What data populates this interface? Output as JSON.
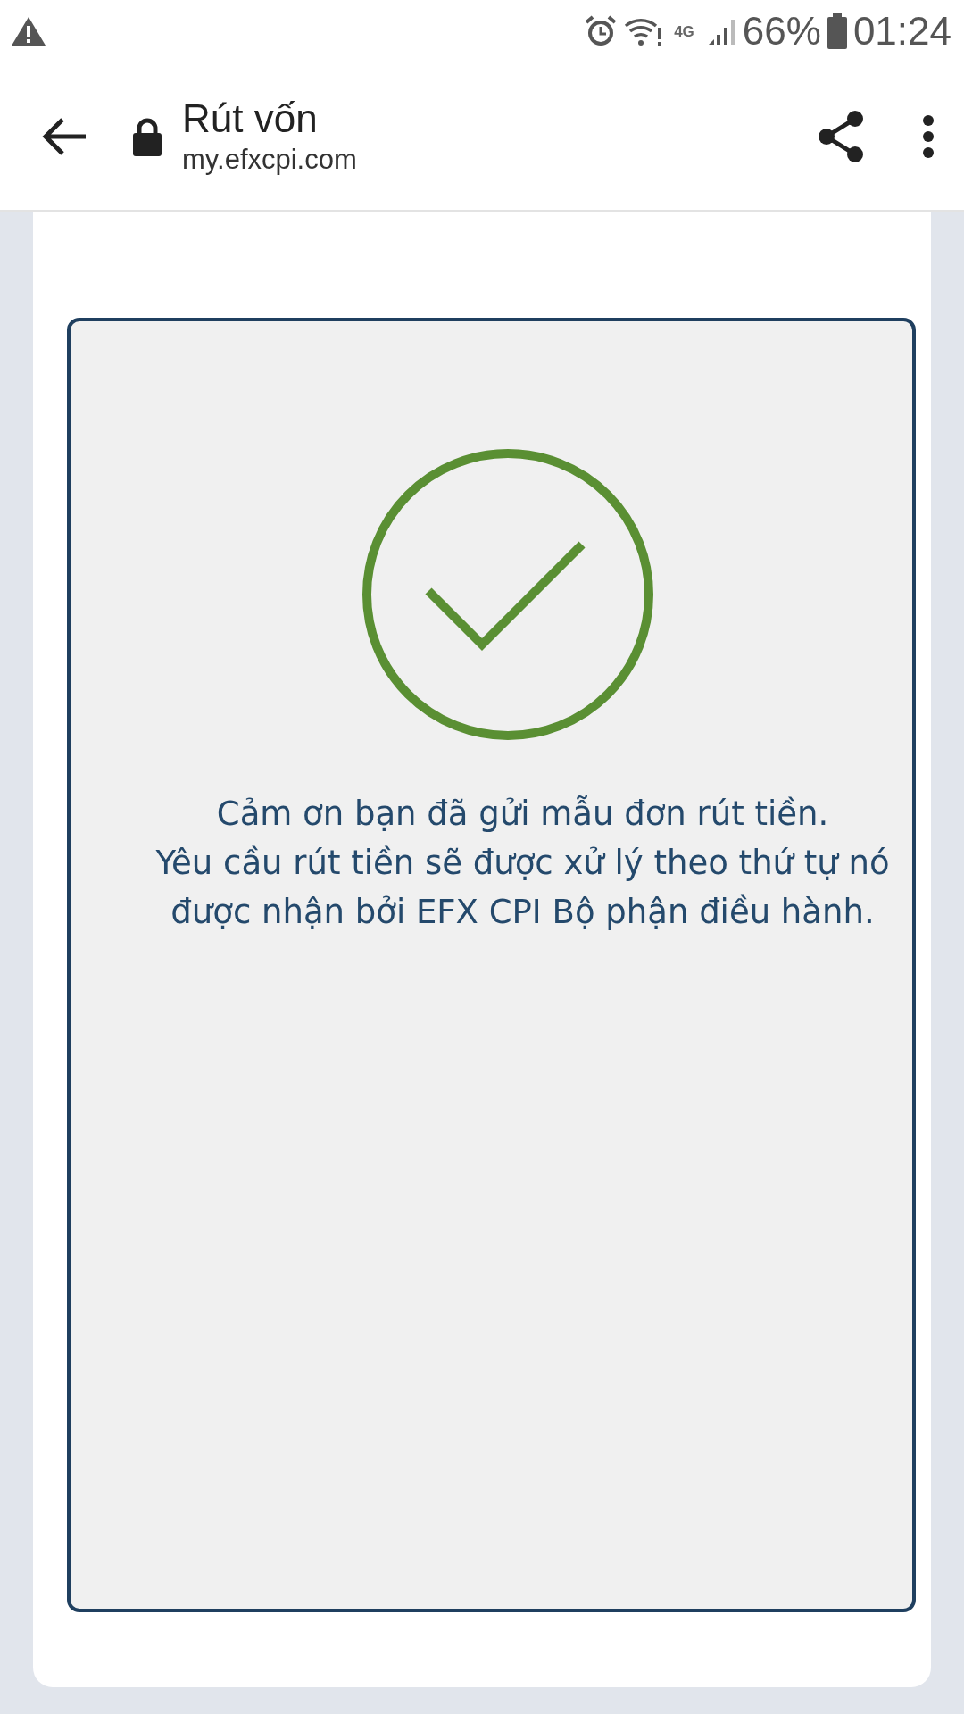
{
  "status_bar": {
    "network": "4G",
    "battery": "66%",
    "time": "01:24"
  },
  "browser_bar": {
    "title": "Rút vốn",
    "url": "my.efxcpi.com"
  },
  "page": {
    "success": {
      "message": [
        "Cảm ơn bạn đã gửi mẫu đơn rút tiền.",
        "Yêu cầu rút tiền sẽ được xử lý theo thứ tự nó được nhận bởi EFX CPI Bộ phận điều hành."
      ]
    }
  }
}
